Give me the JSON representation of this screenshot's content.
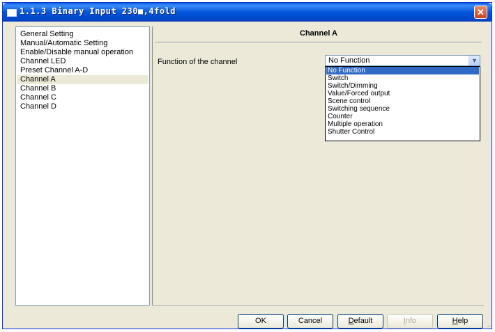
{
  "window": {
    "title": "1.1.3 Binary Input 230■,4fold",
    "close_glyph": "✕"
  },
  "sidebar": {
    "items": [
      {
        "label": "General Setting",
        "selected": false
      },
      {
        "label": "Manual/Automatic Setting",
        "selected": false
      },
      {
        "label": "Enable/Disable manual operation",
        "selected": false
      },
      {
        "label": "Channel LED",
        "selected": false
      },
      {
        "label": "Preset Channel A-D",
        "selected": false
      },
      {
        "label": "Channel A",
        "selected": true
      },
      {
        "label": "Channel B",
        "selected": false
      },
      {
        "label": "Channel C",
        "selected": false
      },
      {
        "label": "Channel D",
        "selected": false
      }
    ]
  },
  "panel": {
    "title": "Channel A",
    "function_label": "Function of the channel",
    "function_value": "No Function",
    "options": [
      "No Function",
      "Switch",
      "Switch/Dimming",
      "Value/Forced output",
      "Scene control",
      "Switching sequence",
      "Counter",
      "Multiple operation",
      "Shutter Control"
    ],
    "selected_option": "No Function"
  },
  "buttons": {
    "ok": "OK",
    "cancel": "Cancel",
    "default_first": "D",
    "default_rest": "efault",
    "info_first": "I",
    "info_rest": "nfo",
    "help_first": "H",
    "help_rest": "elp"
  },
  "colors": {
    "selection_highlight": "#316ac5",
    "title_bar": "#0355d8"
  }
}
